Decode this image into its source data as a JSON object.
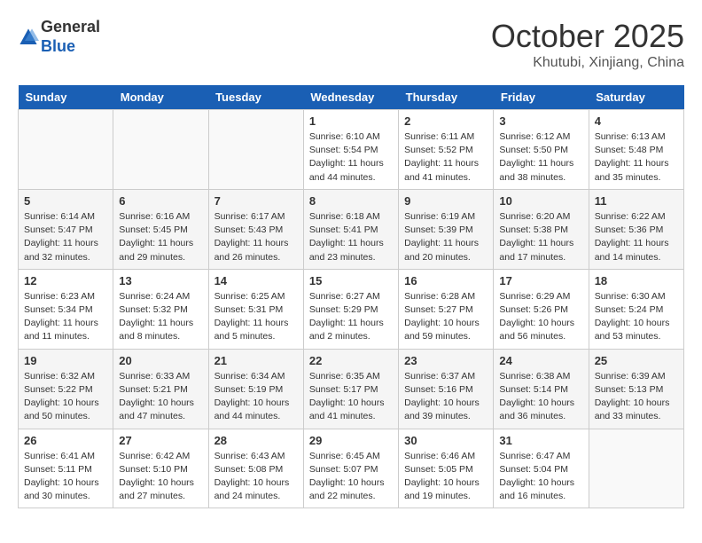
{
  "header": {
    "logo_line1": "General",
    "logo_line2": "Blue",
    "title": "October 2025",
    "subtitle": "Khutubi, Xinjiang, China"
  },
  "days_of_week": [
    "Sunday",
    "Monday",
    "Tuesday",
    "Wednesday",
    "Thursday",
    "Friday",
    "Saturday"
  ],
  "weeks": [
    [
      {
        "date": "",
        "info": ""
      },
      {
        "date": "",
        "info": ""
      },
      {
        "date": "",
        "info": ""
      },
      {
        "date": "1",
        "info": "Sunrise: 6:10 AM\nSunset: 5:54 PM\nDaylight: 11 hours and 44 minutes."
      },
      {
        "date": "2",
        "info": "Sunrise: 6:11 AM\nSunset: 5:52 PM\nDaylight: 11 hours and 41 minutes."
      },
      {
        "date": "3",
        "info": "Sunrise: 6:12 AM\nSunset: 5:50 PM\nDaylight: 11 hours and 38 minutes."
      },
      {
        "date": "4",
        "info": "Sunrise: 6:13 AM\nSunset: 5:48 PM\nDaylight: 11 hours and 35 minutes."
      }
    ],
    [
      {
        "date": "5",
        "info": "Sunrise: 6:14 AM\nSunset: 5:47 PM\nDaylight: 11 hours and 32 minutes."
      },
      {
        "date": "6",
        "info": "Sunrise: 6:16 AM\nSunset: 5:45 PM\nDaylight: 11 hours and 29 minutes."
      },
      {
        "date": "7",
        "info": "Sunrise: 6:17 AM\nSunset: 5:43 PM\nDaylight: 11 hours and 26 minutes."
      },
      {
        "date": "8",
        "info": "Sunrise: 6:18 AM\nSunset: 5:41 PM\nDaylight: 11 hours and 23 minutes."
      },
      {
        "date": "9",
        "info": "Sunrise: 6:19 AM\nSunset: 5:39 PM\nDaylight: 11 hours and 20 minutes."
      },
      {
        "date": "10",
        "info": "Sunrise: 6:20 AM\nSunset: 5:38 PM\nDaylight: 11 hours and 17 minutes."
      },
      {
        "date": "11",
        "info": "Sunrise: 6:22 AM\nSunset: 5:36 PM\nDaylight: 11 hours and 14 minutes."
      }
    ],
    [
      {
        "date": "12",
        "info": "Sunrise: 6:23 AM\nSunset: 5:34 PM\nDaylight: 11 hours and 11 minutes."
      },
      {
        "date": "13",
        "info": "Sunrise: 6:24 AM\nSunset: 5:32 PM\nDaylight: 11 hours and 8 minutes."
      },
      {
        "date": "14",
        "info": "Sunrise: 6:25 AM\nSunset: 5:31 PM\nDaylight: 11 hours and 5 minutes."
      },
      {
        "date": "15",
        "info": "Sunrise: 6:27 AM\nSunset: 5:29 PM\nDaylight: 11 hours and 2 minutes."
      },
      {
        "date": "16",
        "info": "Sunrise: 6:28 AM\nSunset: 5:27 PM\nDaylight: 10 hours and 59 minutes."
      },
      {
        "date": "17",
        "info": "Sunrise: 6:29 AM\nSunset: 5:26 PM\nDaylight: 10 hours and 56 minutes."
      },
      {
        "date": "18",
        "info": "Sunrise: 6:30 AM\nSunset: 5:24 PM\nDaylight: 10 hours and 53 minutes."
      }
    ],
    [
      {
        "date": "19",
        "info": "Sunrise: 6:32 AM\nSunset: 5:22 PM\nDaylight: 10 hours and 50 minutes."
      },
      {
        "date": "20",
        "info": "Sunrise: 6:33 AM\nSunset: 5:21 PM\nDaylight: 10 hours and 47 minutes."
      },
      {
        "date": "21",
        "info": "Sunrise: 6:34 AM\nSunset: 5:19 PM\nDaylight: 10 hours and 44 minutes."
      },
      {
        "date": "22",
        "info": "Sunrise: 6:35 AM\nSunset: 5:17 PM\nDaylight: 10 hours and 41 minutes."
      },
      {
        "date": "23",
        "info": "Sunrise: 6:37 AM\nSunset: 5:16 PM\nDaylight: 10 hours and 39 minutes."
      },
      {
        "date": "24",
        "info": "Sunrise: 6:38 AM\nSunset: 5:14 PM\nDaylight: 10 hours and 36 minutes."
      },
      {
        "date": "25",
        "info": "Sunrise: 6:39 AM\nSunset: 5:13 PM\nDaylight: 10 hours and 33 minutes."
      }
    ],
    [
      {
        "date": "26",
        "info": "Sunrise: 6:41 AM\nSunset: 5:11 PM\nDaylight: 10 hours and 30 minutes."
      },
      {
        "date": "27",
        "info": "Sunrise: 6:42 AM\nSunset: 5:10 PM\nDaylight: 10 hours and 27 minutes."
      },
      {
        "date": "28",
        "info": "Sunrise: 6:43 AM\nSunset: 5:08 PM\nDaylight: 10 hours and 24 minutes."
      },
      {
        "date": "29",
        "info": "Sunrise: 6:45 AM\nSunset: 5:07 PM\nDaylight: 10 hours and 22 minutes."
      },
      {
        "date": "30",
        "info": "Sunrise: 6:46 AM\nSunset: 5:05 PM\nDaylight: 10 hours and 19 minutes."
      },
      {
        "date": "31",
        "info": "Sunrise: 6:47 AM\nSunset: 5:04 PM\nDaylight: 10 hours and 16 minutes."
      },
      {
        "date": "",
        "info": ""
      }
    ]
  ]
}
